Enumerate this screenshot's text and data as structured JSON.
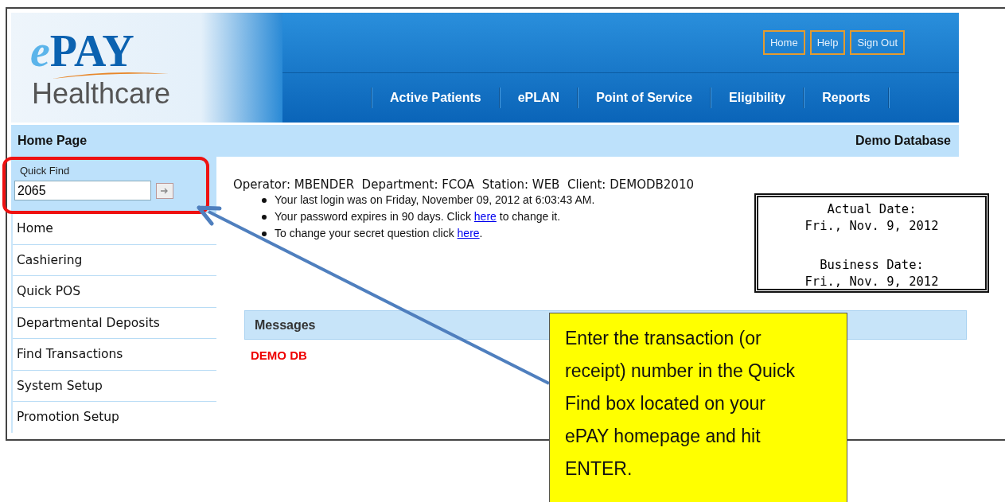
{
  "logo": {
    "prefix": "e",
    "name": "PAY",
    "tagline": "Healthcare"
  },
  "top_links": [
    "Home",
    "Help",
    "Sign Out"
  ],
  "nav": [
    "Active Patients",
    "ePLAN",
    "Point of Service",
    "Eligibility",
    "Reports"
  ],
  "subheader": {
    "title": "Home Page",
    "database": "Demo Database"
  },
  "quick_find": {
    "label": "Quick Find",
    "value": "2065"
  },
  "sidebar": {
    "items": [
      "Home",
      "Cashiering",
      "Quick POS",
      "Departmental Deposits",
      "Find Transactions",
      "System Setup",
      "Promotion Setup"
    ]
  },
  "session": {
    "line": "Operator: MBENDER  Department: FCOA  Station: WEB  Client: DEMODB2010",
    "bullets": [
      {
        "before": "Your last login was on Friday, November 09, 2012 at 6:03:43 AM."
      },
      {
        "before": "Your password expires in 90 days. Click ",
        "link": "here",
        "after": " to change it."
      },
      {
        "before": "To change your secret question click ",
        "link": "here",
        "after": "."
      }
    ]
  },
  "dates": {
    "actual_label": "Actual Date:",
    "actual": "Fri., Nov. 9, 2012",
    "business_label": "Business Date:",
    "business": "Fri., Nov. 9, 2012"
  },
  "messages": {
    "title": "Messages",
    "items": [
      "DEMO DB"
    ]
  },
  "callout": {
    "text": "Enter the transaction (or receipt) number in the Quick Find box located on your ePAY homepage and hit ENTER."
  }
}
